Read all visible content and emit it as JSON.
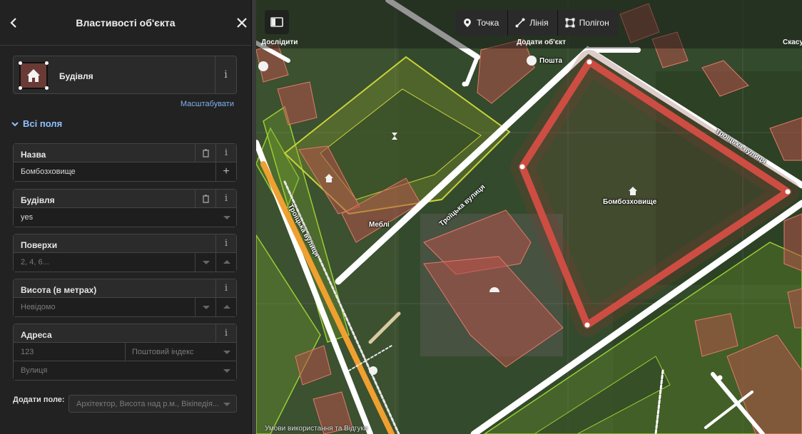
{
  "panel": {
    "title": "Властивості об'єкта",
    "back_icon": "chevron-left-icon",
    "close_icon": "close-icon"
  },
  "preset": {
    "name": "Будівля",
    "icon": "building-icon",
    "info": "i"
  },
  "zoom_to": "Масштабувати",
  "section": {
    "label": "Всі поля"
  },
  "fields": {
    "name": {
      "label": "Назва",
      "value": "Бомбозховище"
    },
    "building": {
      "label": "Будівля",
      "value": "yes"
    },
    "levels": {
      "label": "Поверхи",
      "placeholder": "2, 4, 6..."
    },
    "height": {
      "label": "Висота (в метрах)",
      "placeholder": "Невідомо"
    },
    "address": {
      "label": "Адреса",
      "housenumber_placeholder": "123",
      "postcode_placeholder": "Поштовий індекс",
      "street_placeholder": "Вулиця"
    }
  },
  "add_field": {
    "label": "Додати поле:",
    "placeholder": "Архітектор, Висота над р.м., Вікіпедія..."
  },
  "map": {
    "toolbar": {
      "explore_label": "Дослідити",
      "add_label": "Додати об'єкт",
      "right_label": "Скасу",
      "modes": [
        "Точка",
        "Лінія",
        "Полігон"
      ]
    },
    "labels": {
      "selected_area": "Бомбозховище",
      "street_top": "Троїцька вулиця",
      "street_mid": "Троїцька вулиця",
      "street_left": "Троїцька вулиця",
      "poi_top": "Пошта",
      "poi_mid": "Меблі"
    },
    "attribution": "Умови використання та Відгуки",
    "colors": {
      "selected_outline": "#e8534a",
      "building_fill": "#b4524a",
      "park_outline": "#9acd32"
    }
  }
}
